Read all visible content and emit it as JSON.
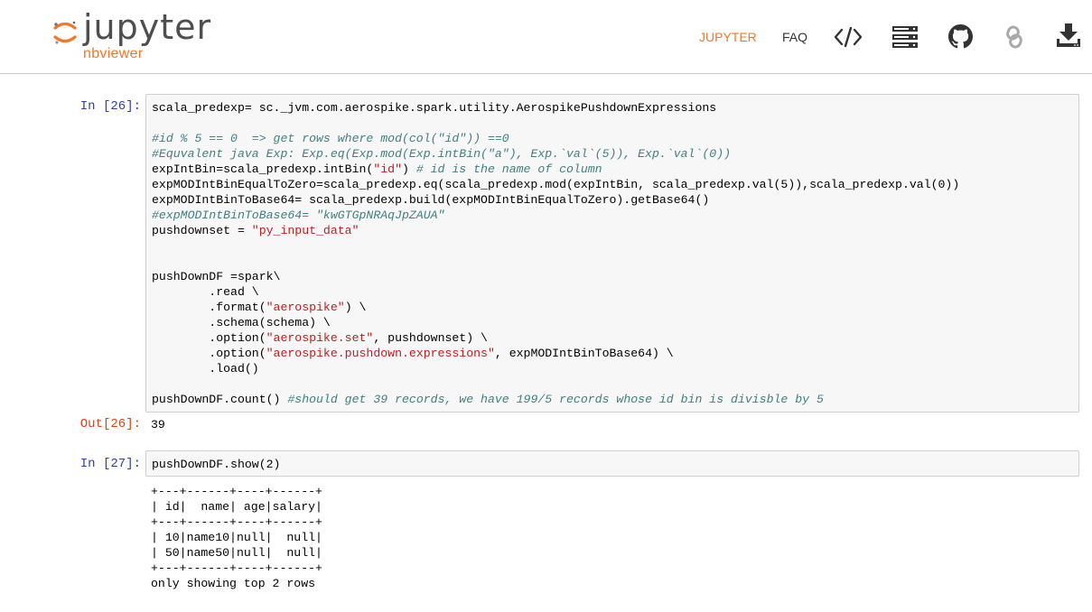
{
  "brand": {
    "name": "jupyter",
    "sub": "nbviewer",
    "accent": "#f37726"
  },
  "nav": {
    "links": [
      "JUPYTER",
      "FAQ"
    ],
    "icons": [
      "code-view-icon",
      "server-icon",
      "github-icon",
      "link-icon",
      "download-icon"
    ]
  },
  "cells": [
    {
      "prompt": "In [26]:",
      "code_lines": [
        "scala_predexp= sc._jvm.com.aerospike.spark.utility.AerospikePushdownExpressions",
        "",
        "#id % 5 == 0  => get rows where mod(col(\"id\")) ==0",
        "#Equvalent java Exp: Exp.eq(Exp.mod(Exp.intBin(\"a\"), Exp.`val`(5)), Exp.`val`(0))",
        "expIntBin=scala_predexp.intBin(\"id\") # id is the name of column",
        "expMODIntBinEqualToZero=scala_predexp.eq(scala_predexp.mod(expIntBin, scala_predexp.val(5)),scala_predexp.val(0))",
        "expMODIntBinToBase64= scala_predexp.build(expMODIntBinEqualToZero).getBase64()",
        "#expMODIntBinToBase64= \"kwGTGpNRAqJpZAUA\"",
        "pushdownset = \"py_input_data\"",
        "",
        "",
        "pushDownDF =spark\\",
        "        .read \\",
        "        .format(\"aerospike\") \\",
        "        .schema(schema) \\",
        "        .option(\"aerospike.set\", pushdownset) \\",
        "        .option(\"aerospike.pushdown.expressions\", expMODIntBinToBase64) \\",
        "        .load()",
        "",
        "pushDownDF.count() #should get 39 records, we have 199/5 records whose id bin is divisble by 5"
      ],
      "out_prompt": "Out[26]:",
      "output": "39"
    },
    {
      "prompt": "In [27]:",
      "code_lines": [
        "pushDownDF.show(2)"
      ],
      "output_lines": [
        "+---+------+----+------+",
        "| id|  name| age|salary|",
        "+---+------+----+------+",
        "| 10|name10|null|  null|",
        "| 50|name50|null|  null|",
        "+---+------+----+------+",
        "only showing top 2 rows"
      ]
    }
  ]
}
